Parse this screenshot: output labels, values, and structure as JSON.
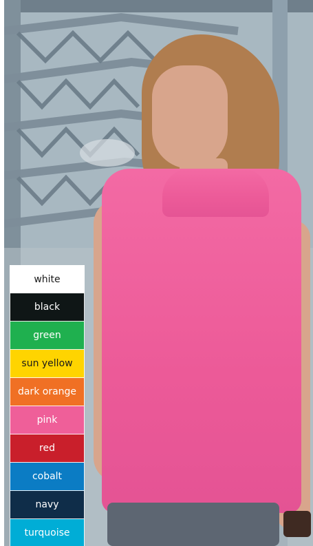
{
  "swatches": [
    {
      "label": "white",
      "bg": "#ffffff",
      "fg": "#1a1a1a"
    },
    {
      "label": "black",
      "bg": "#0f1616",
      "fg": "#ffffff"
    },
    {
      "label": "green",
      "bg": "#1fb04f",
      "fg": "#ffffff"
    },
    {
      "label": "sun yellow",
      "bg": "#ffd400",
      "fg": "#1a1a1a"
    },
    {
      "label": "dark orange",
      "bg": "#f07024",
      "fg": "#ffffff"
    },
    {
      "label": "pink",
      "bg": "#ef5f99",
      "fg": "#ffffff"
    },
    {
      "label": "red",
      "bg": "#c91f2b",
      "fg": "#ffffff"
    },
    {
      "label": "cobalt",
      "bg": "#0b7cc4",
      "fg": "#ffffff"
    },
    {
      "label": "navy",
      "bg": "#0f2d49",
      "fg": "#ffffff"
    },
    {
      "label": "turquoise",
      "bg": "#00add6",
      "fg": "#ffffff"
    }
  ]
}
